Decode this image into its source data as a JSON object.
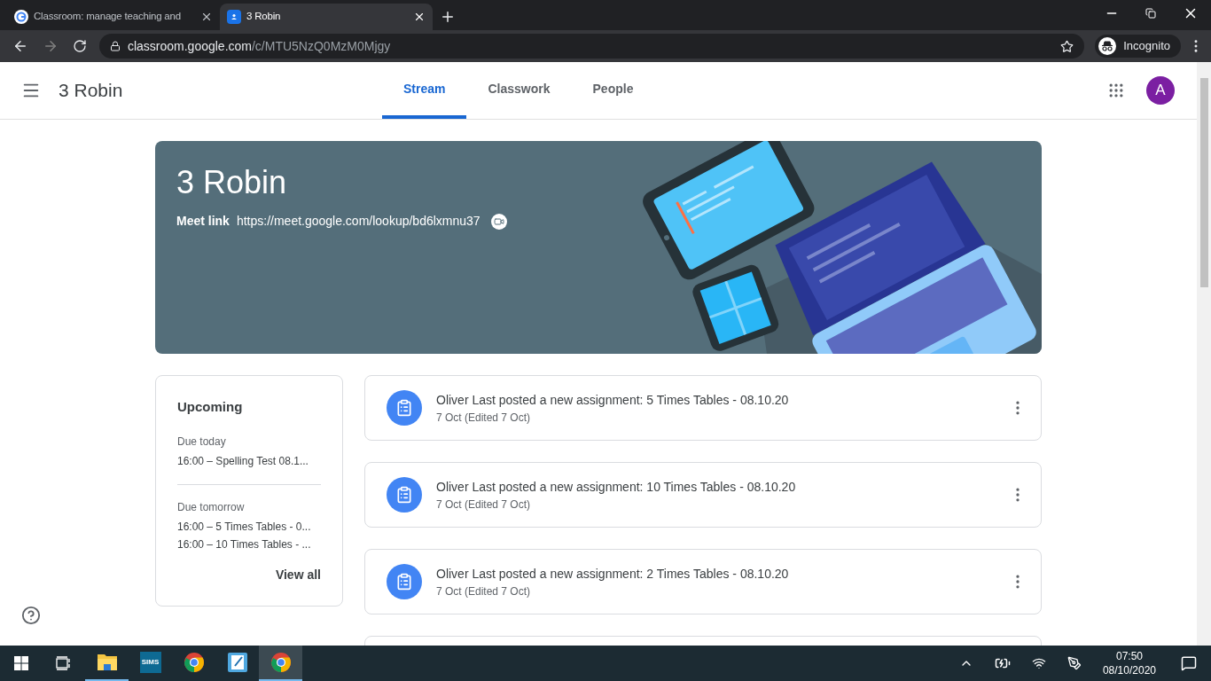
{
  "browser": {
    "tabs": [
      {
        "title": "Classroom: manage teaching and",
        "kind": "google",
        "selected": false
      },
      {
        "title": "3 Robin",
        "kind": "classroom",
        "selected": true
      }
    ],
    "address": {
      "host": "classroom.google.com",
      "path": "/c/MTU5NzQ0MzM0Mjgy"
    },
    "profile": "Incognito"
  },
  "header": {
    "title": "3 Robin",
    "tabs": [
      {
        "label": "Stream",
        "selected": true
      },
      {
        "label": "Classwork",
        "selected": false
      },
      {
        "label": "People",
        "selected": false
      }
    ],
    "avatar": "A"
  },
  "banner": {
    "title": "3 Robin",
    "meet_label": "Meet link",
    "meet_url": "https://meet.google.com/lookup/bd6lxmnu37"
  },
  "upcoming": {
    "title": "Upcoming",
    "groups": [
      {
        "heading": "Due today",
        "items": [
          "16:00 – Spelling Test 08.1..."
        ]
      },
      {
        "heading": "Due tomorrow",
        "items": [
          "16:00 – 5 Times Tables - 0...",
          "16:00 – 10 Times Tables - ..."
        ]
      }
    ],
    "view_all": "View all"
  },
  "posts": [
    {
      "text": "Oliver Last posted a new assignment: 5 Times Tables - 08.10.20",
      "date": "7 Oct (Edited 7 Oct)"
    },
    {
      "text": "Oliver Last posted a new assignment: 10 Times Tables - 08.10.20",
      "date": "7 Oct (Edited 7 Oct)"
    },
    {
      "text": "Oliver Last posted a new assignment: 2 Times Tables - 08.10.20",
      "date": "7 Oct (Edited 7 Oct)"
    }
  ],
  "taskbar": {
    "apps": [
      {
        "kind": "folder",
        "running": true,
        "selected": false
      },
      {
        "kind": "sims",
        "label": "SIMS",
        "running": false,
        "selected": false
      },
      {
        "kind": "chrome",
        "running": false,
        "selected": false
      },
      {
        "kind": "notes",
        "running": false,
        "selected": false
      },
      {
        "kind": "chrome",
        "running": true,
        "selected": true
      }
    ],
    "time": "07:50",
    "date": "08/10/2020"
  }
}
